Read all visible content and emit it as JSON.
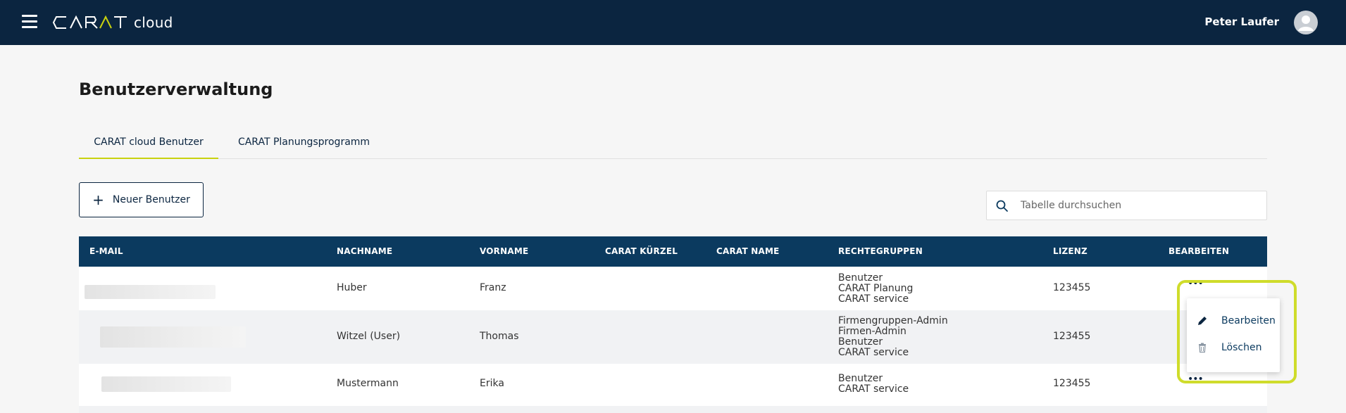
{
  "header": {
    "logo_text": "CARAT",
    "logo_suffix": "cloud",
    "user_name": "Peter Laufer"
  },
  "page": {
    "title": "Benutzerverwaltung"
  },
  "tabs": [
    {
      "label": "CARAT cloud Benutzer",
      "active": true
    },
    {
      "label": "CARAT Planungsprogramm",
      "active": false
    }
  ],
  "toolbar": {
    "new_user_label": "Neuer Benutzer",
    "search_placeholder": "Tabelle durchsuchen"
  },
  "table": {
    "columns": [
      "E-MAIL",
      "NACHNAME",
      "VORNAME",
      "CARAT KÜRZEL",
      "CARAT NAME",
      "RECHTEGRUPPEN",
      "LIZENZ",
      "BEARBEITEN"
    ],
    "rows": [
      {
        "email": "",
        "nachname": "Huber",
        "vorname": "Franz",
        "kuerzel": "",
        "name": "",
        "gruppen": [
          "Benutzer",
          "CARAT Planung",
          "CARAT service"
        ],
        "lizenz": "123455"
      },
      {
        "email": "",
        "nachname": "Witzel (User)",
        "vorname": "Thomas",
        "kuerzel": "",
        "name": "",
        "gruppen": [
          "Firmengruppen-Admin",
          "Firmen-Admin",
          "Benutzer",
          "CARAT service"
        ],
        "lizenz": "123455"
      },
      {
        "email": "",
        "nachname": "Mustermann",
        "vorname": "Erika",
        "kuerzel": "",
        "name": "",
        "gruppen": [
          "Benutzer",
          "CARAT service"
        ],
        "lizenz": "123455"
      }
    ],
    "actions_glyph": "•••"
  },
  "context_menu": {
    "items": [
      {
        "label": "Bearbeiten",
        "icon": "pencil-icon"
      },
      {
        "label": "Löschen",
        "icon": "trash-icon"
      }
    ]
  },
  "colors": {
    "header_bg": "#0b2540",
    "table_header_bg": "#0b3a5f",
    "accent": "#c9d20f",
    "highlight": "#cfdc2b"
  }
}
